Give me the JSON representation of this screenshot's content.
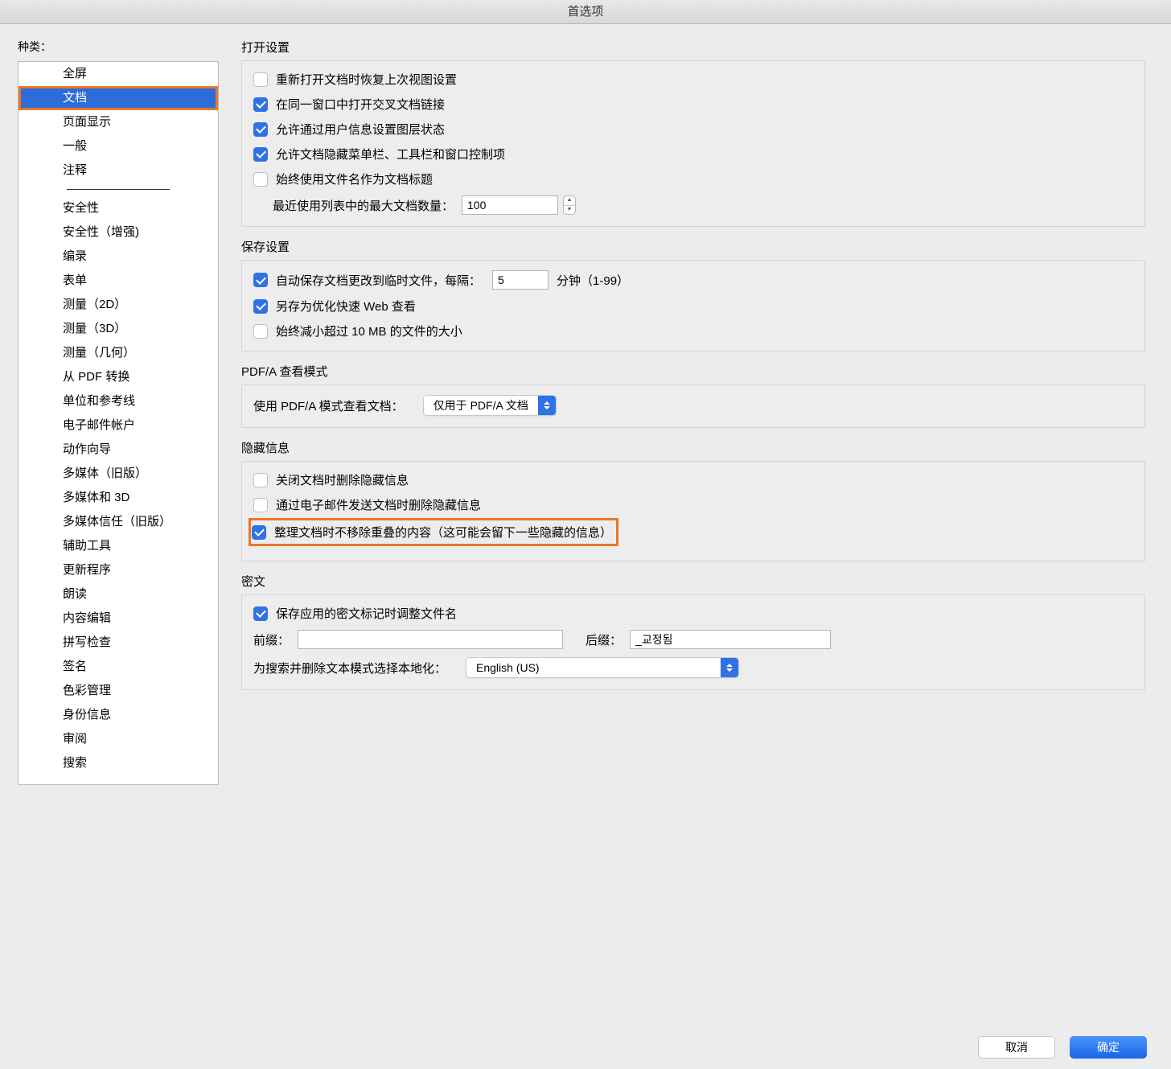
{
  "window_title": "首选项",
  "sidebar": {
    "label": "种类：",
    "groups": {
      "top": [
        "全屏",
        "文档",
        "页面显示",
        "一般",
        "注释"
      ],
      "bottom": [
        "安全性",
        "安全性（增强)",
        "编录",
        "表单",
        "测量（2D）",
        "测量（3D）",
        "测量（几何）",
        "从 PDF 转换",
        "单位和参考线",
        "电子邮件帐户",
        "动作向导",
        "多媒体（旧版）",
        "多媒体和 3D",
        "多媒体信任（旧版）",
        "辅助工具",
        "更新程序",
        "朗读",
        "内容编辑",
        "拼写检查",
        "签名",
        "色彩管理",
        "身份信息",
        "审阅",
        "搜索"
      ]
    },
    "selected": "文档"
  },
  "sections": {
    "open": {
      "title": "打开设置",
      "restore_view": "重新打开文档时恢复上次视图设置",
      "cross_doc": "在同一窗口中打开交叉文档链接",
      "layer_state": "允许通过用户信息设置图层状态",
      "hide_ui": "允许文档隐藏菜单栏、工具栏和窗口控制项",
      "use_filename": "始终使用文件名作为文档标题",
      "recent_label": "最近使用列表中的最大文档数量：",
      "recent_value": "100"
    },
    "save": {
      "title": "保存设置",
      "autosave_prefix": "自动保存文档更改到临时文件，每隔：",
      "autosave_value": "5",
      "autosave_suffix": "分钟（1-99）",
      "fast_web": "另存为优化快速 Web 查看",
      "reduce_size": "始终减小超过 10 MB 的文件的大小"
    },
    "pdfa": {
      "title": "PDF/A 查看模式",
      "label": "使用 PDF/A 模式查看文档：",
      "value": "仅用于 PDF/A 文档"
    },
    "hidden": {
      "title": "隐藏信息",
      "on_close": "关闭文档时删除隐藏信息",
      "on_email": "通过电子邮件发送文档时删除隐藏信息",
      "overlap": "整理文档时不移除重叠的内容（这可能会留下一些隐藏的信息）"
    },
    "redact": {
      "title": "密文",
      "adjust_name": "保存应用的密文标记时调整文件名",
      "prefix_label": "前缀：",
      "prefix_value": "",
      "suffix_label": "后缀：",
      "suffix_value": "_교정됨",
      "loc_label": "为搜索并删除文本模式选择本地化：",
      "loc_value": "English (US)"
    }
  },
  "buttons": {
    "cancel": "取消",
    "ok": "确定"
  }
}
